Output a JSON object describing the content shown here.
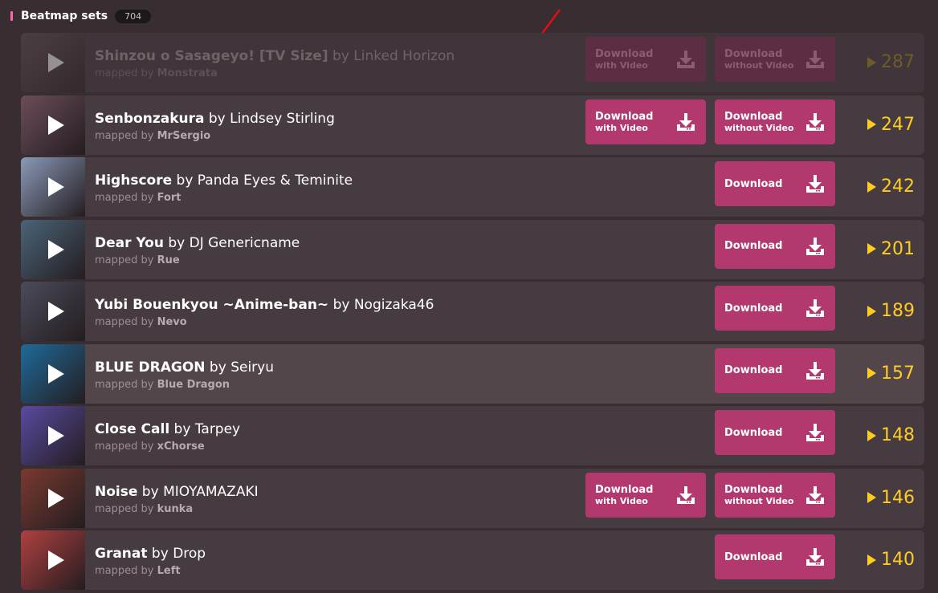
{
  "section": {
    "title": "Beatmap sets",
    "count": "704"
  },
  "labels": {
    "download": "Download",
    "with_video": "with Video",
    "without_video": "without Video",
    "mapped_by": "mapped by"
  },
  "colors": {
    "accent": "#b3386e",
    "plays": "#ffcc22",
    "background": "#382e32"
  },
  "rows": [
    {
      "title": "Shinzou o Sasageyo! [TV Size]",
      "artist": "Linked Horizon",
      "mapper": "Monstrata",
      "plays": "287",
      "video": true,
      "state": "faded",
      "thumb": "#5a4a50"
    },
    {
      "title": "Senbonzakura",
      "artist": "Lindsey Stirling",
      "mapper": "MrSergio",
      "plays": "247",
      "video": true,
      "state": "normal",
      "thumb": "#6b4d5a"
    },
    {
      "title": "Highscore",
      "artist": "Panda Eyes & Teminite",
      "mapper": "Fort",
      "plays": "242",
      "video": false,
      "state": "normal",
      "thumb": "#8a9ab8"
    },
    {
      "title": "Dear You",
      "artist": "DJ Genericname",
      "mapper": "Rue",
      "plays": "201",
      "video": false,
      "state": "normal",
      "thumb": "#4a6478"
    },
    {
      "title": "Yubi Bouenkyou ~Anime-ban~",
      "artist": "Nogizaka46",
      "mapper": "Nevo",
      "plays": "189",
      "video": false,
      "state": "normal",
      "thumb": "#4b4b5a"
    },
    {
      "title": "BLUE DRAGON",
      "artist": "Seiryu",
      "mapper": "Blue Dragon",
      "plays": "157",
      "video": false,
      "state": "hover",
      "thumb": "#1f6a9a"
    },
    {
      "title": "Close Call",
      "artist": "Tarpey",
      "mapper": "xChorse",
      "plays": "148",
      "video": false,
      "state": "normal",
      "thumb": "#5a4aa0"
    },
    {
      "title": "Noise",
      "artist": "MIOYAMAZAKI",
      "mapper": "kunka",
      "plays": "146",
      "video": true,
      "state": "normal",
      "thumb": "#7a3a30"
    },
    {
      "title": "Granat",
      "artist": "Drop",
      "mapper": "Left",
      "plays": "140",
      "video": false,
      "state": "normal",
      "thumb": "#b04040"
    }
  ]
}
